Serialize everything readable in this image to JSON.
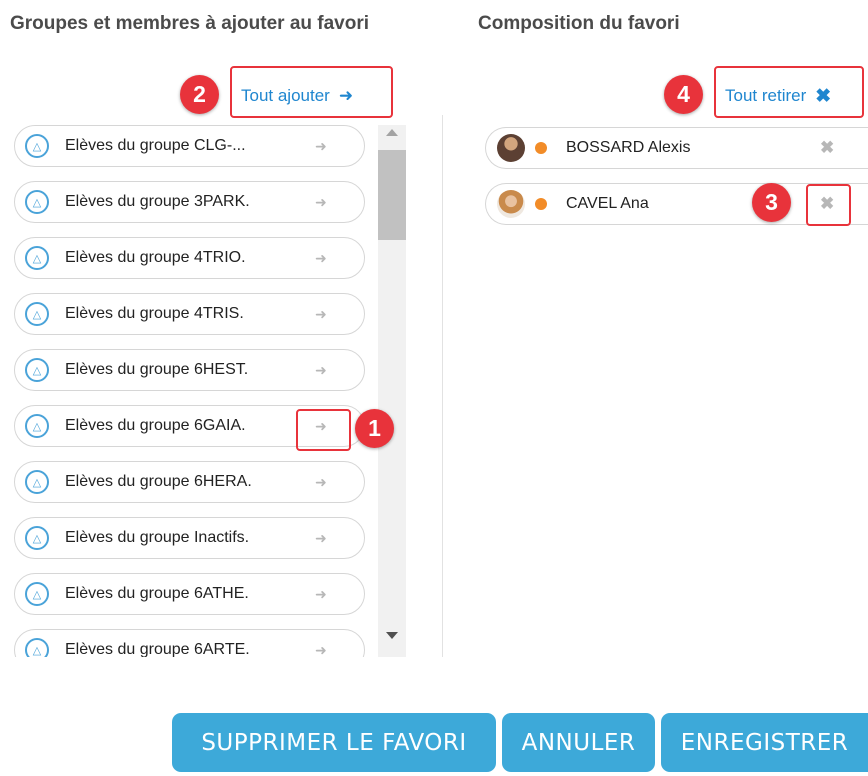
{
  "left_panel": {
    "title": "Groupes et membres à ajouter au favori",
    "add_all_label": "Tout ajouter",
    "groups": [
      {
        "label": "Elèves du groupe CLG-..."
      },
      {
        "label": "Elèves du groupe 3PARK."
      },
      {
        "label": "Elèves du groupe 4TRIO."
      },
      {
        "label": "Elèves du groupe 4TRIS."
      },
      {
        "label": "Elèves du groupe 6HEST."
      },
      {
        "label": "Elèves du groupe 6GAIA."
      },
      {
        "label": "Elèves du groupe 6HERA."
      },
      {
        "label": "Elèves du groupe Inactifs."
      },
      {
        "label": "Elèves du groupe 6ATHE."
      },
      {
        "label": "Elèves du groupe 6ARTE."
      }
    ]
  },
  "right_panel": {
    "title": "Composition du favori",
    "remove_all_label": "Tout retirer",
    "members": [
      {
        "name": "BOSSARD Alexis",
        "status_color": "#f28c28"
      },
      {
        "name": "CAVEL Ana",
        "status_color": "#f28c28"
      }
    ]
  },
  "callouts": {
    "one": "1",
    "two": "2",
    "three": "3",
    "four": "4"
  },
  "footer": {
    "delete_label": "SUPPRIMER LE FAVORI",
    "cancel_label": "ANNULER",
    "save_label": "ENREGISTRER"
  },
  "colors": {
    "accent": "#1f86cf",
    "button": "#3da9d9",
    "callout": "#e8333b",
    "status": "#f28c28"
  },
  "icons": {
    "group": "group-icon",
    "add_arrow": "arrow-right-icon",
    "remove": "close-icon"
  }
}
